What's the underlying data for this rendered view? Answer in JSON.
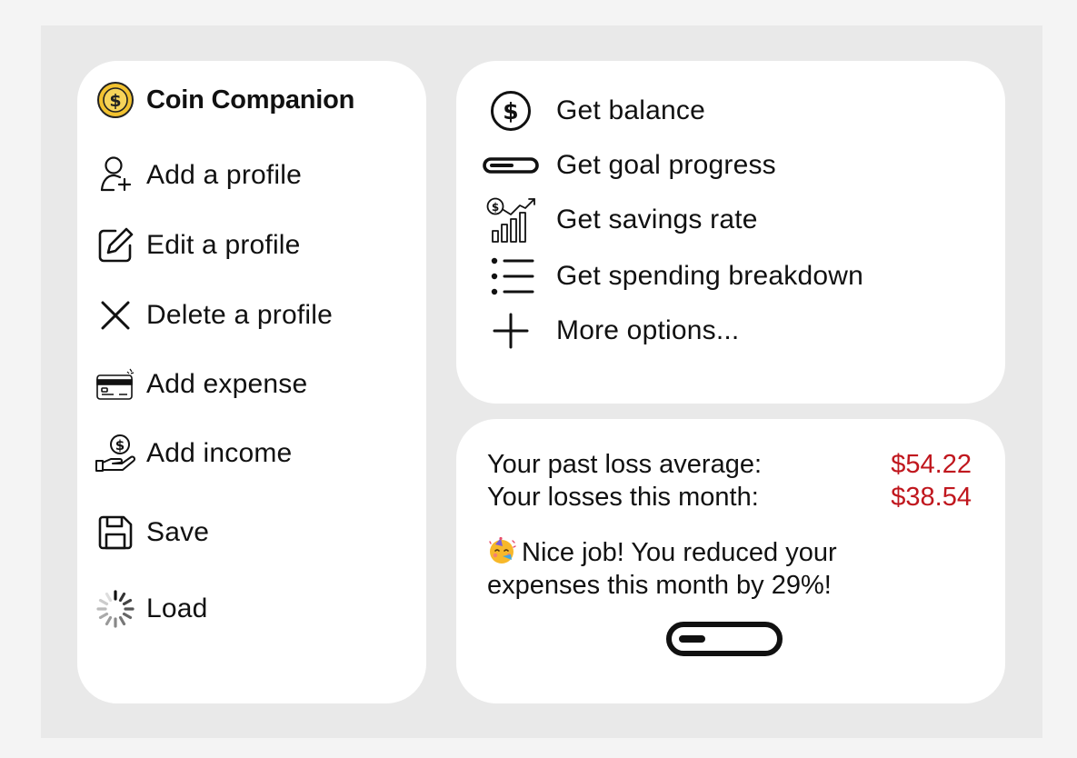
{
  "sidebar": {
    "brand": {
      "icon": "coin-dollar-icon",
      "title": "Coin Companion",
      "accent": "#f2c230"
    },
    "items": [
      {
        "icon": "user-plus-icon",
        "label": "Add a profile"
      },
      {
        "icon": "edit-icon",
        "label": "Edit a profile"
      },
      {
        "icon": "close-icon",
        "label": "Delete a profile"
      },
      {
        "icon": "credit-card-icon",
        "label": "Add expense"
      },
      {
        "icon": "hand-coin-icon",
        "label": "Add income"
      },
      {
        "icon": "save-icon",
        "label": "Save"
      },
      {
        "icon": "loading-spinner-icon",
        "label": "Load"
      }
    ]
  },
  "actions": {
    "items": [
      {
        "icon": "dollar-circle-icon",
        "label": "Get balance"
      },
      {
        "icon": "progress-bar-icon",
        "label": "Get goal progress"
      },
      {
        "icon": "savings-chart-icon",
        "label": "Get savings rate"
      },
      {
        "icon": "list-icon",
        "label": "Get spending breakdown"
      },
      {
        "icon": "plus-icon",
        "label": "More options..."
      }
    ]
  },
  "summary": {
    "past_average_label": "Your past loss average:",
    "past_average_value": "$54.22",
    "this_month_label": "Your losses this month:",
    "this_month_value": "$38.54",
    "value_color": "#c0171e",
    "message_icon": "party-face-icon",
    "message": "Nice job! You reduced your expenses this month by 29%!",
    "progress_icon": "progress-bar-icon",
    "progress_fraction": 0.29
  }
}
